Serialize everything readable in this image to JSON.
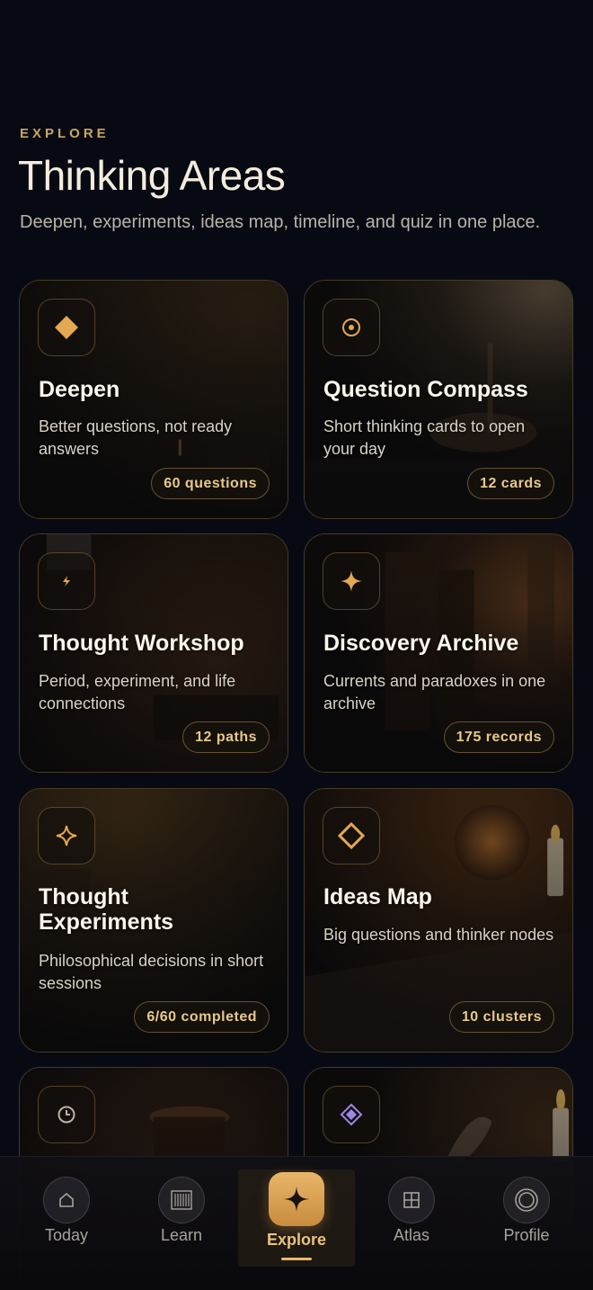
{
  "header": {
    "eyebrow": "EXPLORE",
    "title": "Thinking Areas",
    "subtitle": "Deepen, experiments, ideas map, timeline, and quiz in one place."
  },
  "cards": [
    {
      "title": "Deepen",
      "desc": "Better questions, not ready answers",
      "badge": "60 questions",
      "icon": "diamond-icon"
    },
    {
      "title": "Question Compass",
      "desc": "Short thinking cards to open your day",
      "badge": "12 cards",
      "icon": "target-icon"
    },
    {
      "title": "Thought Workshop",
      "desc": "Period, experiment, and life connections",
      "badge": "12 paths",
      "icon": "bolt-icon"
    },
    {
      "title": "Discovery Archive",
      "desc": "Currents and paradoxes in one archive",
      "badge": "175 records",
      "icon": "sparkle-icon"
    },
    {
      "title": "Thought Experiments",
      "desc": "Philosophical decisions in short sessions",
      "badge": "6/60 completed",
      "icon": "sparkle-outline-icon"
    },
    {
      "title": "Ideas Map",
      "desc": "Big questions and thinker nodes",
      "badge": "10 clusters",
      "icon": "diamond-outline-icon"
    },
    {
      "title": "",
      "desc": "",
      "badge": "",
      "icon": "clock-icon"
    },
    {
      "title": "",
      "desc": "",
      "badge": "",
      "icon": "purple-diamond-icon"
    }
  ],
  "nav": {
    "items": [
      {
        "label": "Today",
        "icon": "home-icon"
      },
      {
        "label": "Learn",
        "icon": "library-icon"
      },
      {
        "label": "Explore",
        "icon": "star-icon",
        "active": true
      },
      {
        "label": "Atlas",
        "icon": "grid-icon"
      },
      {
        "label": "Profile",
        "icon": "profile-ring-icon"
      }
    ]
  },
  "colors": {
    "background": "#080a13",
    "accent": "#c9a561",
    "active": "#e8b86a"
  }
}
